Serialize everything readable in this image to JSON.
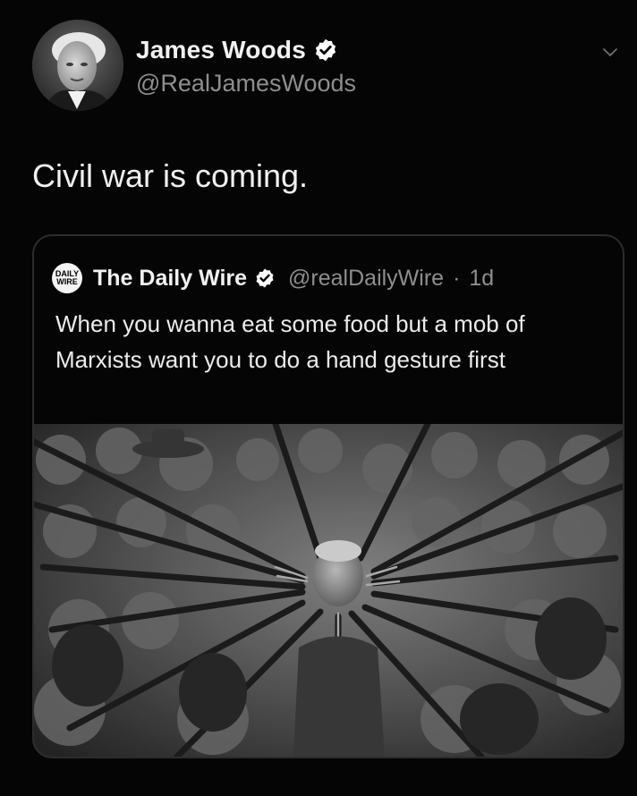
{
  "author": {
    "name": "James Woods",
    "handle": "@RealJamesWoods",
    "verified": true,
    "avatar": "portrait-photo-icon"
  },
  "tweet": {
    "text": "Civil war is coming."
  },
  "menu": {
    "icon": "chevron-down-icon"
  },
  "quote": {
    "logo_line1": "DAILY",
    "logo_line2": "WIRE",
    "name": "The Daily Wire",
    "verified": true,
    "handle": "@realDailyWire",
    "separator": "·",
    "time": "1d",
    "text": "When you wanna eat some food but a mob of Marxists want you to do a hand gesture first",
    "image": "black-and-white-photo-soldiers-pointing-bayonets-at-old-man"
  },
  "colors": {
    "background": "#050505",
    "primary_text": "#f0f0f0",
    "secondary_text": "#8e8e8e",
    "card_border": "#2c2c2c",
    "verified_badge": "#ffffff"
  }
}
